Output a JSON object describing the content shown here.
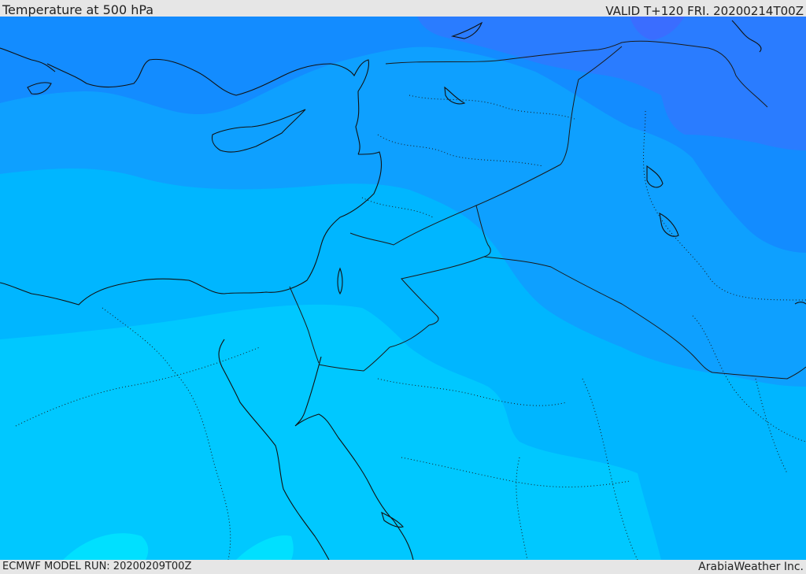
{
  "header": {
    "title": "Temperature at 500 hPa",
    "valid": "VALID T+120 FRI. 20200214T00Z"
  },
  "footer": {
    "model_run": "ECMWF MODEL RUN: 20200209T00Z",
    "brand": "ArabiaWeather Inc."
  },
  "colors": {
    "coldest": "#2b7bff",
    "cold": "#1a8cff",
    "cool": "#0ea3ff",
    "mild": "#00b4ff",
    "warm": "#00cbff",
    "warmest": "#00e4ff",
    "coast": "#111111",
    "border": "#1a1a1a"
  }
}
